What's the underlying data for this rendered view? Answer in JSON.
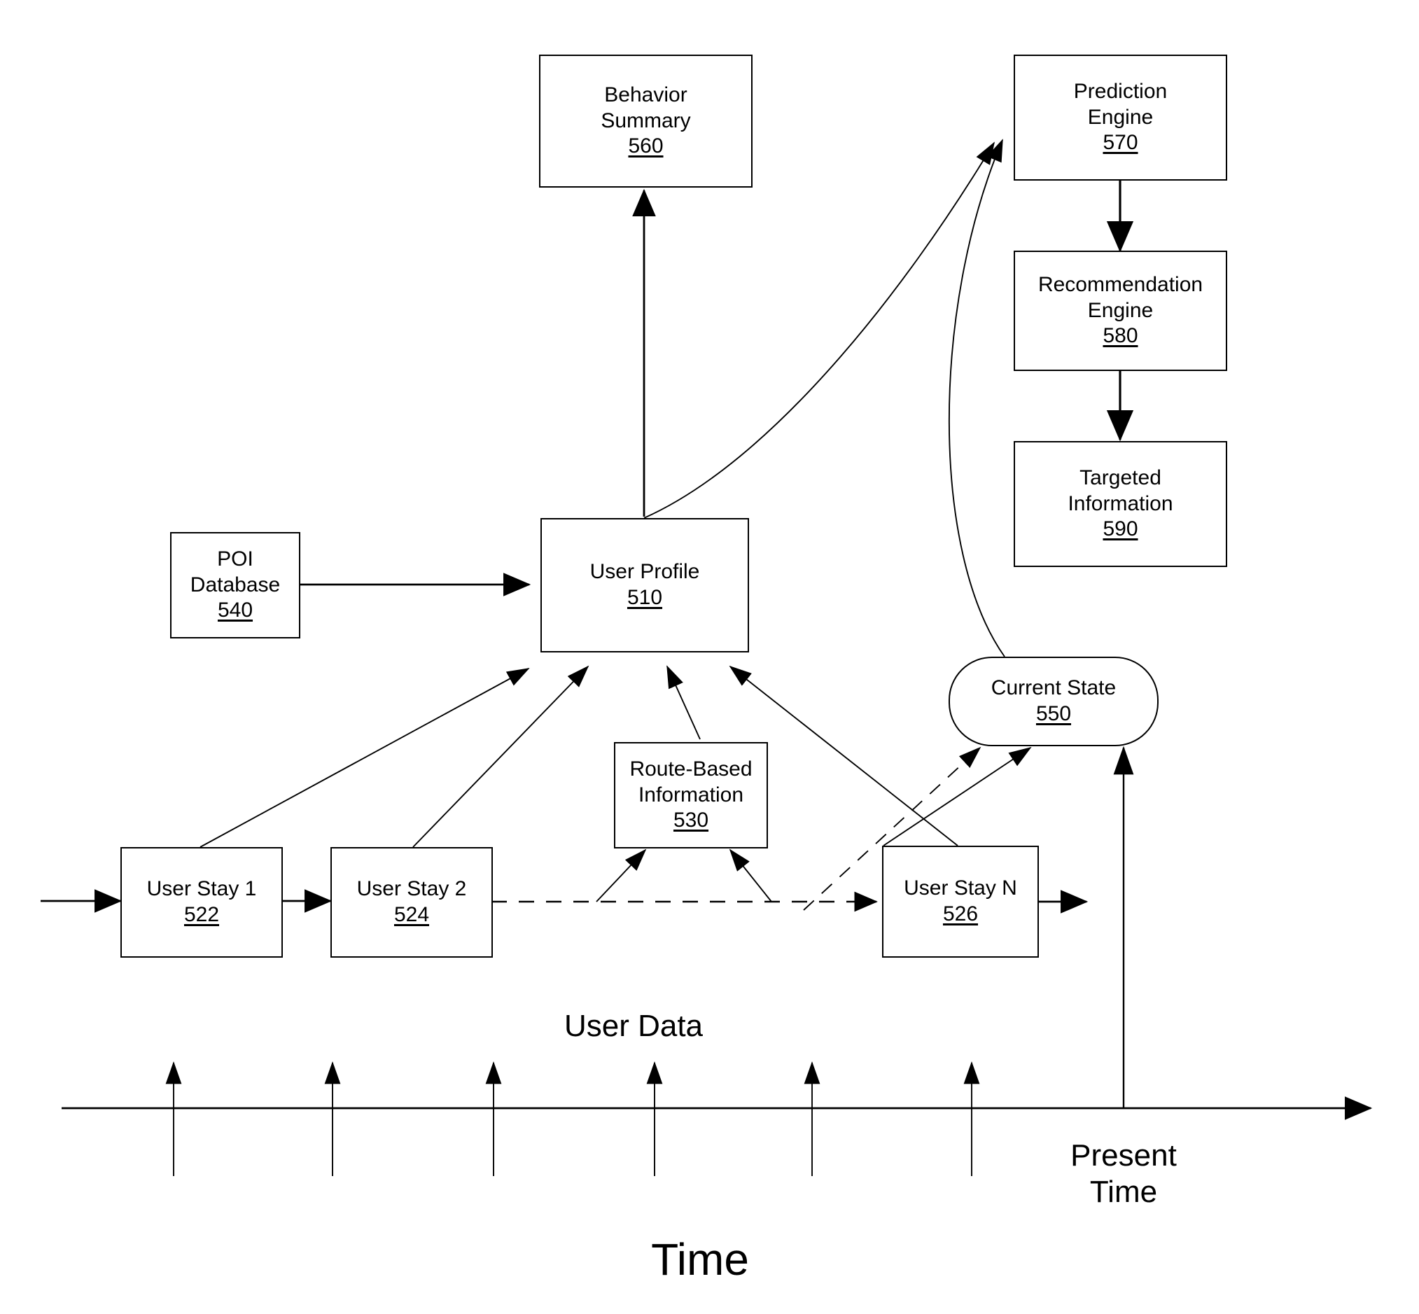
{
  "figure": {
    "type": "patent-flow-diagram",
    "background_color": "#ffffff",
    "line_color": "#000000"
  },
  "nodes": [
    {
      "id": "behavior_summary",
      "name": "behavior-summary-box",
      "shape": "rectangle",
      "title_line_1": "Behavior",
      "title_line_2": "Summary",
      "ref": "560"
    },
    {
      "id": "prediction_engine",
      "name": "prediction-engine-box",
      "shape": "rectangle",
      "title_line_1": "Prediction",
      "title_line_2": "Engine",
      "ref": "570"
    },
    {
      "id": "recommendation_engine",
      "name": "recommendation-engine-box",
      "shape": "rectangle",
      "title_line_1": "Recommendation",
      "title_line_2": "Engine",
      "ref": "580"
    },
    {
      "id": "targeted_information",
      "name": "targeted-information-box",
      "shape": "rectangle",
      "title_line_1": "Targeted",
      "title_line_2": "Information",
      "ref": "590"
    },
    {
      "id": "poi_database",
      "name": "poi-database-box",
      "shape": "rectangle",
      "title_line_1": "POI",
      "title_line_2": "Database",
      "ref": "540"
    },
    {
      "id": "user_profile",
      "name": "user-profile-box",
      "shape": "rectangle",
      "title_line_1": "User Profile",
      "title_line_2": "",
      "ref": "510"
    },
    {
      "id": "current_state",
      "name": "current-state-box",
      "shape": "rounded-rectangle",
      "title_line_1": "Current State",
      "title_line_2": "",
      "ref": "550"
    },
    {
      "id": "route_based_information",
      "name": "route-based-information-box",
      "shape": "rectangle",
      "title_line_1": "Route-Based",
      "title_line_2": "Information",
      "ref": "530"
    },
    {
      "id": "user_stay_1",
      "name": "user-stay-1-box",
      "shape": "rectangle",
      "title_line_1": "User Stay 1",
      "title_line_2": "",
      "ref": "522"
    },
    {
      "id": "user_stay_2",
      "name": "user-stay-2-box",
      "shape": "rectangle",
      "title_line_1": "User Stay 2",
      "title_line_2": "",
      "ref": "524"
    },
    {
      "id": "user_stay_n",
      "name": "user-stay-n-box",
      "shape": "rectangle",
      "title_line_1": "User Stay N",
      "title_line_2": "",
      "ref": "526"
    }
  ],
  "labels": {
    "user_data": "User Data",
    "present_time_line_1": "Present",
    "present_time_line_2": "Time",
    "time_axis": "Time"
  },
  "connections": [
    {
      "from": "poi_database",
      "to": "user_profile",
      "style": "solid"
    },
    {
      "from": "user_profile",
      "to": "behavior_summary",
      "style": "solid"
    },
    {
      "from": "user_profile",
      "to": "prediction_engine",
      "style": "solid-curve"
    },
    {
      "from": "current_state",
      "to": "prediction_engine",
      "style": "solid-curve"
    },
    {
      "from": "prediction_engine",
      "to": "recommendation_engine",
      "style": "solid"
    },
    {
      "from": "recommendation_engine",
      "to": "targeted_information",
      "style": "solid"
    },
    {
      "from": "user_stay_1",
      "to": "user_profile",
      "style": "solid"
    },
    {
      "from": "user_stay_2",
      "to": "user_profile",
      "style": "solid"
    },
    {
      "from": "route_based_information",
      "to": "user_profile",
      "style": "solid"
    },
    {
      "from": "user_stay_n",
      "to": "user_profile",
      "style": "solid"
    },
    {
      "from": "user_stay_1",
      "to": "user_stay_2",
      "style": "solid"
    },
    {
      "from": "user_stay_2",
      "to": "user_stay_n",
      "style": "dashed"
    },
    {
      "from": "user_stay_2",
      "to": "route_based_information",
      "style": "solid"
    },
    {
      "from": "user_stay_n",
      "to": "route_based_information",
      "style": "solid"
    },
    {
      "from": "user_stay_2",
      "to": "current_state",
      "style": "dashed"
    },
    {
      "from": "user_stay_n",
      "to": "current_state",
      "style": "solid"
    },
    {
      "from": "present_time",
      "to": "current_state",
      "style": "solid"
    }
  ],
  "timeline": {
    "tick_count": 6,
    "axis_label": "Time",
    "present_marker_label": "Present Time"
  }
}
